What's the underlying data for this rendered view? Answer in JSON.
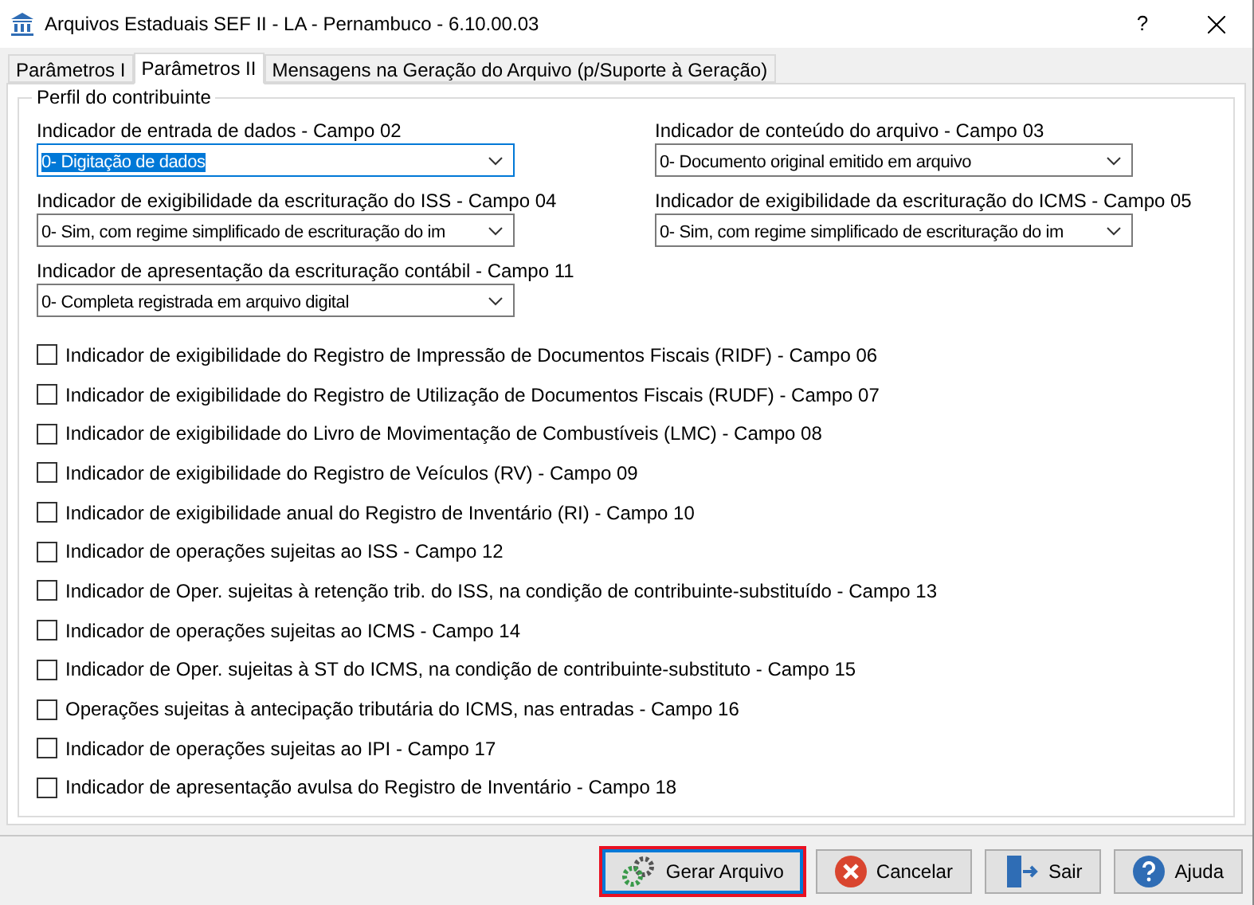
{
  "window": {
    "title": "Arquivos Estaduais SEF II - LA - Pernambuco - 6.10.00.03",
    "help": "?"
  },
  "tabs": [
    {
      "label": "Parâmetros I",
      "selected": false
    },
    {
      "label": "Parâmetros II",
      "selected": true
    },
    {
      "label": "Mensagens na Geração do Arquivo (p/Suporte à Geração)",
      "selected": false
    }
  ],
  "group": {
    "title": "Perfil do contribuinte",
    "dropdowns": [
      {
        "label": "Indicador de entrada de dados - Campo 02",
        "value": "0- Digitação de dados",
        "selected": true
      },
      {
        "label": "Indicador de conteúdo do arquivo - Campo 03",
        "value": "0- Documento original emitido em arquivo",
        "selected": false
      },
      {
        "label": "Indicador de exigibilidade da escrituração do ISS - Campo 04",
        "value": "0- Sim, com regime simplificado de escrituração do im",
        "selected": false
      },
      {
        "label": "Indicador de exigibilidade da escrituração do ICMS - Campo 05",
        "value": "0- Sim, com regime simplificado de escrituração do im",
        "selected": false
      },
      {
        "label": "Indicador de apresentação da escrituração contábil - Campo 11",
        "value": "0- Completa registrada em arquivo digital",
        "selected": false
      }
    ],
    "checkboxes": [
      {
        "label": "Indicador de exigibilidade do Registro de Impressão de Documentos Fiscais (RIDF) - Campo 06",
        "checked": false
      },
      {
        "label": "Indicador de exigibilidade do Registro de Utilização de Documentos Fiscais (RUDF) - Campo 07",
        "checked": false
      },
      {
        "label": "Indicador de exigibilidade do Livro de Movimentação de Combustíveis (LMC) - Campo 08",
        "checked": false
      },
      {
        "label": "Indicador de exigibilidade do Registro de Veículos (RV) - Campo 09",
        "checked": false
      },
      {
        "label": "Indicador de exigibilidade anual do Registro de Inventário (RI) - Campo 10",
        "checked": false
      },
      {
        "label": "Indicador de operações sujeitas ao ISS - Campo 12",
        "checked": false
      },
      {
        "label": "Indicador de Oper. sujeitas à retenção trib. do ISS, na condição de contribuinte-substituído - Campo 13",
        "checked": false
      },
      {
        "label": "Indicador de operações sujeitas ao ICMS - Campo 14",
        "checked": false
      },
      {
        "label": "Indicador de Oper. sujeitas à ST do ICMS, na condição de contribuinte-substituto - Campo 15",
        "checked": false
      },
      {
        "label": "Operações sujeitas à antecipação tributária do ICMS, nas entradas - Campo 16",
        "checked": false
      },
      {
        "label": "Indicador de operações sujeitas ao IPI - Campo 17",
        "checked": false
      },
      {
        "label": "Indicador de apresentação avulsa do Registro de Inventário - Campo 18",
        "checked": false
      }
    ]
  },
  "buttons": [
    {
      "kind": "generate",
      "label": "Gerar Arquivo",
      "focused": true
    },
    {
      "kind": "cancel",
      "label": "Cancelar",
      "focused": false
    },
    {
      "kind": "exit",
      "label": "Sair",
      "focused": false
    },
    {
      "kind": "help",
      "label": "Ajuda",
      "focused": false
    }
  ]
}
